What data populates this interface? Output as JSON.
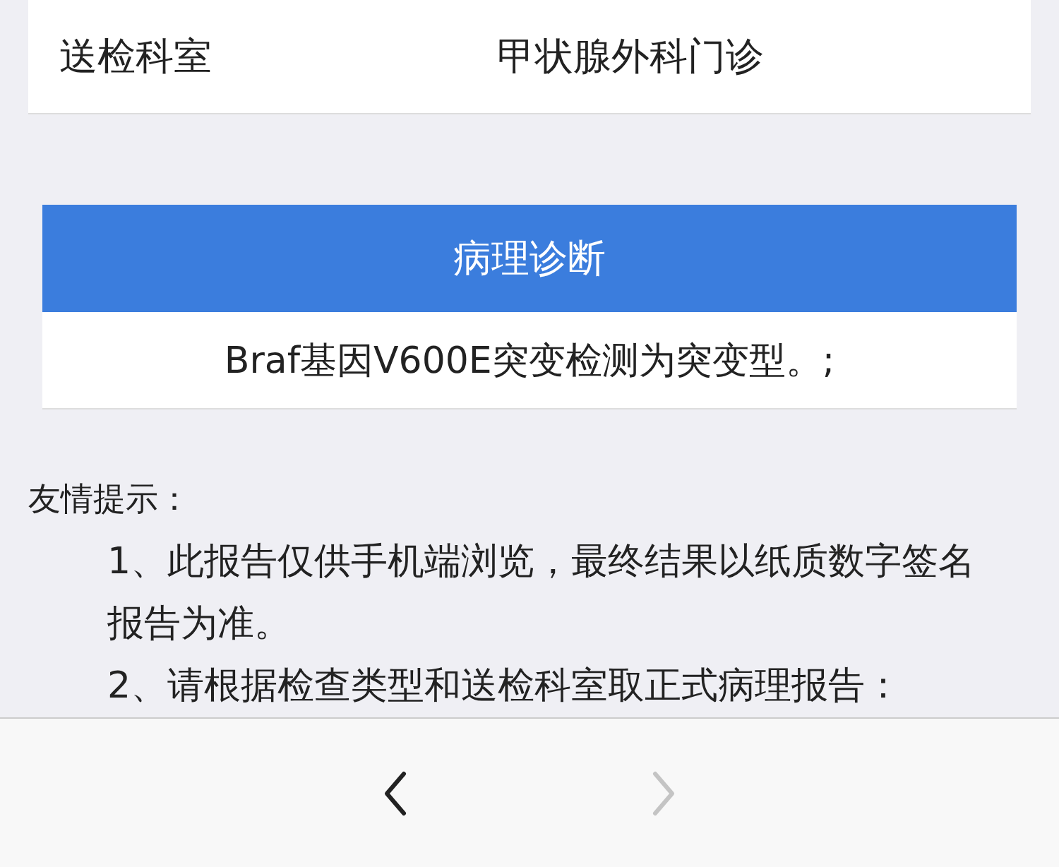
{
  "info_row": {
    "label": "送检科室",
    "value": "甲状腺外科门诊"
  },
  "diagnosis": {
    "title": "病理诊断",
    "text": "Braf基因V600E突变检测为突变型。;"
  },
  "tips": {
    "title": "友情提示：",
    "items": [
      "1、此报告仅供手机端浏览，最终结果以纸质数字签名报告为准。",
      "2、请根据检查类型和送检科室取正式病理报告："
    ]
  },
  "toolbar": {
    "buttons": [
      {
        "kind": "back",
        "disabled": false
      },
      {
        "kind": "forward",
        "disabled": true
      }
    ]
  }
}
